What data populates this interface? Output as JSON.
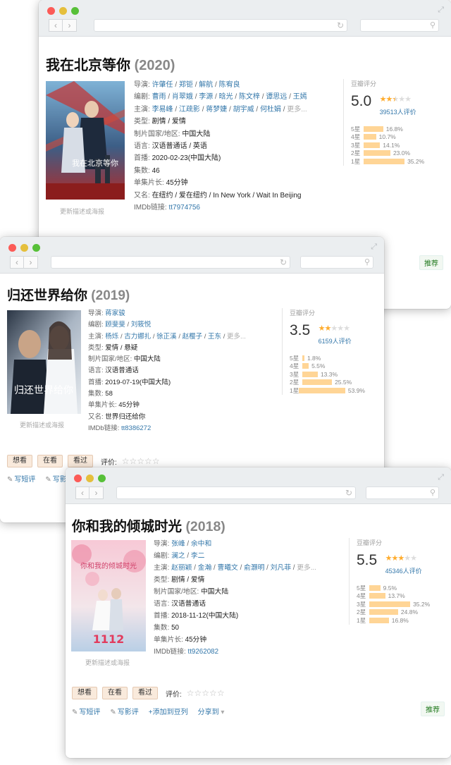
{
  "w1": {
    "title": "我在北京等你",
    "year": "(2020)",
    "poster_caption": "我在北京等你",
    "update_link": "更新描述或海报",
    "directors_label": "导演:",
    "directors": [
      "许肇任",
      "郑钜",
      "解航",
      "陈宥良"
    ],
    "writers_label": "编剧:",
    "writers": [
      "曹雨",
      "肖翠娥",
      "李源",
      "晗光",
      "陈文梓",
      "谭思远",
      "王嫣"
    ],
    "cast_label": "主演:",
    "cast": [
      "李易峰",
      "江疏影",
      "蒋梦婕",
      "胡宇威",
      "何杜娟"
    ],
    "more": "更多...",
    "genre_label": "类型:",
    "genre": "剧情 / 爱情",
    "region_label": "制片国家/地区:",
    "region": "中国大陆",
    "lang_label": "语言:",
    "lang": "汉语普通话 / 英语",
    "premiere_label": "首播:",
    "premiere": "2020-02-23(中国大陆)",
    "episodes_label": "集数:",
    "episodes": "46",
    "runtime_label": "单集片长:",
    "runtime": "45分钟",
    "aka_label": "又名:",
    "aka": "在纽约 / 爱在纽约 / In New York / Wait In Beijing",
    "imdb_label": "IMDb链接:",
    "imdb": "tt7974756",
    "rating_title": "豆瓣评分",
    "score": "5.0",
    "votes": "39513人评价",
    "star_fill": 2.5,
    "dist": [
      {
        "label": "5星",
        "pct": "16.8%",
        "val": 16.8
      },
      {
        "label": "4星",
        "pct": "10.7%",
        "val": 10.7
      },
      {
        "label": "3星",
        "pct": "14.1%",
        "val": 14.1
      },
      {
        "label": "2星",
        "pct": "23.0%",
        "val": 23.0
      },
      {
        "label": "1星",
        "pct": "35.2%",
        "val": 35.2
      }
    ],
    "recommend": "推荐"
  },
  "w2": {
    "title": "归还世界给你",
    "year": "(2019)",
    "poster_caption": "归还世界给你",
    "update_link": "更新描述或海报",
    "directors_label": "导演:",
    "directors": [
      "蒋家骏"
    ],
    "writers_label": "编剧:",
    "writers": [
      "顾斐斐",
      "刘筱悦"
    ],
    "cast_label": "主演:",
    "cast": [
      "杨烁",
      "古力娜扎",
      "徐正溪",
      "赵樱子",
      "王东"
    ],
    "more": "更多...",
    "genre_label": "类型:",
    "genre": "爱情 / 悬疑",
    "region_label": "制片国家/地区:",
    "region": "中国大陆",
    "lang_label": "语言:",
    "lang": "汉语普通话",
    "premiere_label": "首播:",
    "premiere": "2019-07-19(中国大陆)",
    "episodes_label": "集数:",
    "episodes": "58",
    "runtime_label": "单集片长:",
    "runtime": "45分钟",
    "aka_label": "又名:",
    "aka": "世界归还给你",
    "imdb_label": "IMDb链接:",
    "imdb": "tt8386272",
    "rating_title": "豆瓣评分",
    "score": "3.5",
    "votes": "6159人评价",
    "star_fill": 2,
    "dist": [
      {
        "label": "5星",
        "pct": "1.8%",
        "val": 1.8
      },
      {
        "label": "4星",
        "pct": "5.5%",
        "val": 5.5
      },
      {
        "label": "3星",
        "pct": "13.3%",
        "val": 13.3
      },
      {
        "label": "2星",
        "pct": "25.5%",
        "val": 25.5
      },
      {
        "label": "1星",
        "pct": "53.9%",
        "val": 53.9
      }
    ],
    "btn_want": "想看",
    "btn_watching": "在看",
    "btn_watched": "看过",
    "rate_label": "评价:",
    "rate_stars": "☆☆☆☆☆",
    "link_review": "写短评",
    "link_review2": "写影"
  },
  "w3": {
    "title": "你和我的倾城时光",
    "year": "(2018)",
    "poster_caption": "你和我的倾城时光",
    "update_link": "更新描述或海报",
    "directors_label": "导演:",
    "directors": [
      "张峰",
      "余中和"
    ],
    "writers_label": "编剧:",
    "writers": [
      "澜之",
      "李二"
    ],
    "cast_label": "主演:",
    "cast": [
      "赵丽颖",
      "金瀚",
      "曹曦文",
      "俞灏明",
      "刘凡菲"
    ],
    "more": "更多...",
    "genre_label": "类型:",
    "genre": "剧情 / 爱情",
    "region_label": "制片国家/地区:",
    "region": "中国大陆",
    "lang_label": "语言:",
    "lang": "汉语普通话",
    "premiere_label": "首播:",
    "premiere": "2018-11-12(中国大陆)",
    "episodes_label": "集数:",
    "episodes": "50",
    "runtime_label": "单集片长:",
    "runtime": "45分钟",
    "imdb_label": "IMDb链接:",
    "imdb": "tt9262082",
    "rating_title": "豆瓣评分",
    "score": "5.5",
    "votes": "45346人评价",
    "star_fill": 3,
    "dist": [
      {
        "label": "5星",
        "pct": "9.5%",
        "val": 9.5
      },
      {
        "label": "4星",
        "pct": "13.7%",
        "val": 13.7
      },
      {
        "label": "3星",
        "pct": "35.2%",
        "val": 35.2
      },
      {
        "label": "2星",
        "pct": "24.8%",
        "val": 24.8
      },
      {
        "label": "1星",
        "pct": "16.8%",
        "val": 16.8
      }
    ],
    "btn_want": "想看",
    "btn_watching": "在看",
    "btn_watched": "看过",
    "rate_label": "评价:",
    "rate_stars": "☆☆☆☆☆",
    "link_review": "写短评",
    "link_movie_review": "写影评",
    "link_doulist": "+添加到豆列",
    "link_share": "分享到",
    "recommend": "推荐"
  },
  "colors": {
    "link": "#3377aa",
    "bar": "#ffd596",
    "star": "#ffac2d",
    "star_empty": "#dddddd"
  }
}
